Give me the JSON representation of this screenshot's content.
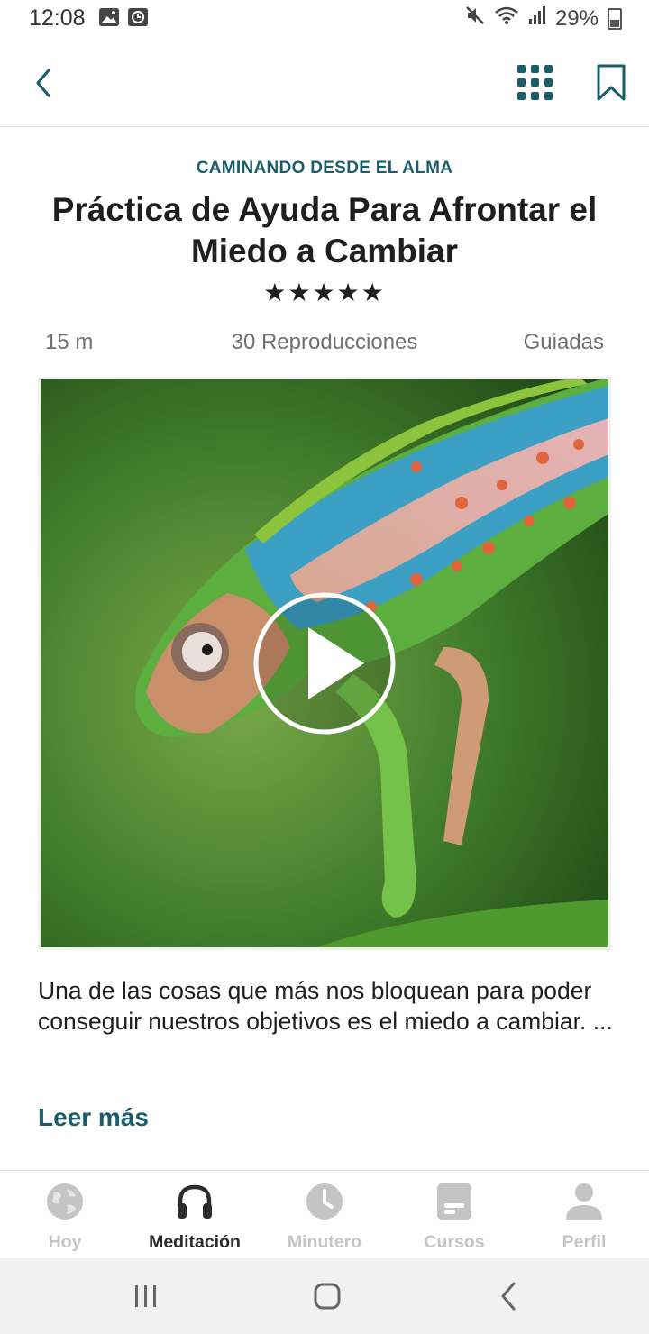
{
  "status_bar": {
    "time": "12:08",
    "battery": "29%"
  },
  "header": {
    "series": "CAMINANDO DESDE EL ALMA",
    "title": "Práctica de Ayuda Para Afrontar el Miedo a Cambiar",
    "stars": "★★★★★",
    "rating": 5
  },
  "meta": {
    "duration": "15 m",
    "plays": "30 Reproducciones",
    "type": "Guiadas"
  },
  "description": "Una de las cosas que más nos bloquean para poder conseguir nuestros objetivos es el miedo a cambiar. ...",
  "read_more": "Leer más",
  "tabs": [
    {
      "label": "Hoy",
      "icon": "globe-icon",
      "active": false
    },
    {
      "label": "Meditación",
      "icon": "headphones-icon",
      "active": true
    },
    {
      "label": "Minutero",
      "icon": "clock-icon",
      "active": false
    },
    {
      "label": "Cursos",
      "icon": "card-icon",
      "active": false
    },
    {
      "label": "Perfil",
      "icon": "person-icon",
      "active": false
    }
  ],
  "colors": {
    "accent": "#1b5e6b",
    "tab_active": "#2c2c2c",
    "tab_inactive": "#c4c4c4"
  }
}
